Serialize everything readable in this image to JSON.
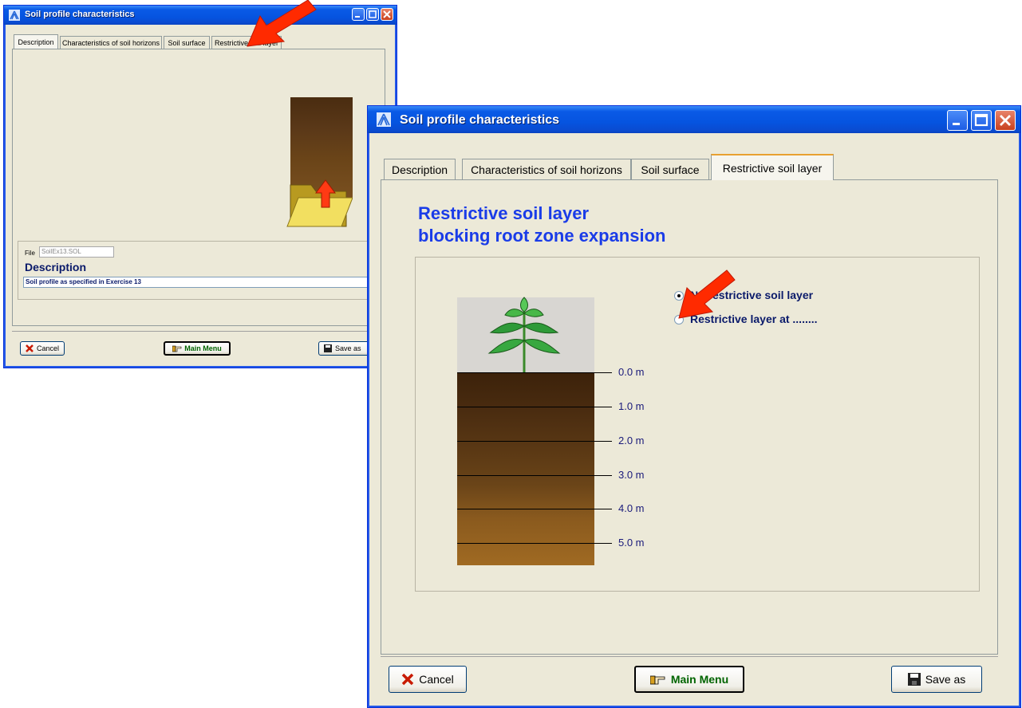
{
  "back_window": {
    "title": "Soil profile characteristics",
    "tabs": [
      "Description",
      "Characteristics of soil horizons",
      "Soil surface",
      "Restrictive soil layer"
    ],
    "file_label": "File",
    "file_value": "SoilEx13.SOL",
    "description_heading": "Description",
    "description_value": "Soil profile as specified in Exercise 13",
    "cancel_label": "Cancel",
    "main_menu_label": "Main Menu",
    "save_as_label": "Save as"
  },
  "front_window": {
    "title": "Soil profile characteristics",
    "tabs": [
      "Description",
      "Characteristics of soil horizons",
      "Soil surface",
      "Restrictive soil layer"
    ],
    "active_tab": "Restrictive soil layer",
    "heading_line1": "Restrictive soil layer",
    "heading_line2": "blocking root zone expansion",
    "option1_label": "No restrictive soil layer",
    "option2_label": "Restrictive layer at ........",
    "depth_labels": [
      "0.0 m",
      "1.0 m",
      "2.0 m",
      "3.0 m",
      "4.0 m",
      "5.0 m"
    ],
    "cancel_label": "Cancel",
    "main_menu_label": "Main Menu",
    "save_as_label": "Save as"
  },
  "colors": {
    "heading": "#1a3ce8",
    "arrow": "#ff2a00",
    "main_menu_text": "#006400"
  }
}
